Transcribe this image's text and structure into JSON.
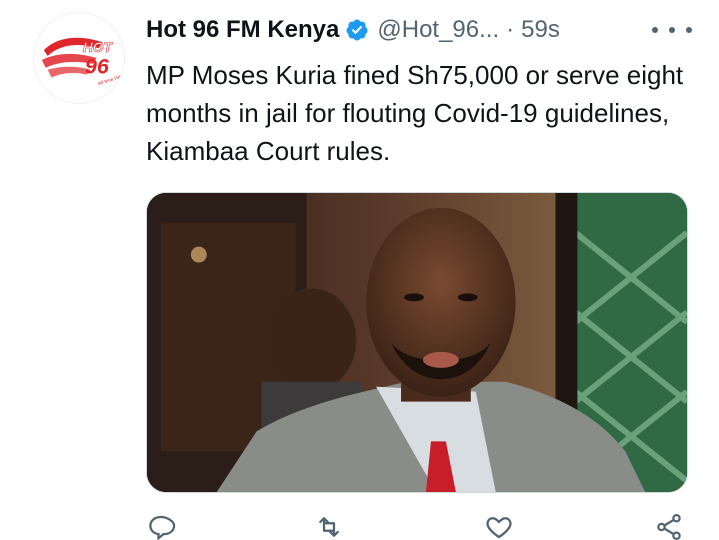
{
  "tweet": {
    "display_name": "Hot 96 FM Kenya",
    "handle": "@Hot_96...",
    "separator": "·",
    "timestamp": "59s",
    "text": "MP Moses Kuria fined Sh75,000 or serve eight months in jail for flouting Covid-19 guidelines, Kiambaa Court rules.",
    "avatar_logo_text": "HOT 96",
    "avatar_tagline": "All time Hits!",
    "verified": true
  },
  "icons": {
    "verified": "verified-badge-icon",
    "more": "more-icon",
    "reply": "reply-icon",
    "retweet": "retweet-icon",
    "like": "like-icon",
    "share": "share-icon"
  },
  "colors": {
    "verified_blue": "#1d9bf0",
    "text_primary": "#0f1419",
    "text_secondary": "#536471",
    "brand_red": "#e0262b"
  }
}
